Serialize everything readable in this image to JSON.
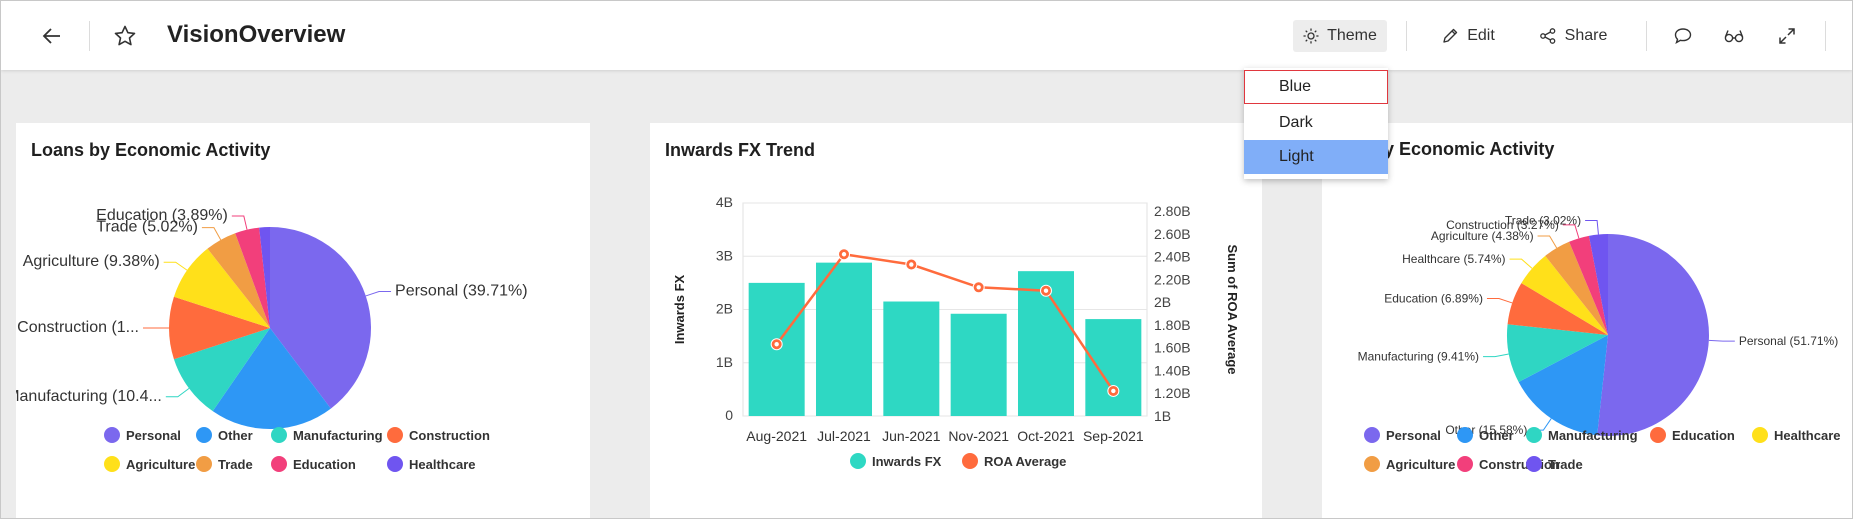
{
  "header": {
    "title": "VisionOverview",
    "theme_label": "Theme",
    "edit_label": "Edit",
    "share_label": "Share"
  },
  "theme_menu": {
    "options": [
      "Blue",
      "Dark",
      "Light"
    ],
    "hovered": "Blue",
    "selected": "Light"
  },
  "colors": {
    "personal": "#7b68ee",
    "other": "#2e97f5",
    "manufacturing": "#2fd6c3",
    "construction": "#ff6b3d",
    "agriculture": "#ffe01a",
    "trade": "#f19d44",
    "education": "#f23f7b",
    "healthcare": "#6f55f0",
    "bar": "#2ed8c3",
    "line": "#ff6b3d",
    "accent_selected": "#80aef8",
    "hover_border": "#e0373e"
  },
  "cards": {
    "loans": {
      "title": "Loans by Economic Activity"
    },
    "fx": {
      "title": "Inwards FX Trend"
    },
    "third": {
      "title": "t by Economic Activity"
    }
  },
  "chart_data": [
    {
      "type": "pie",
      "title": "Loans by Economic Activity",
      "slices": [
        {
          "name": "Personal",
          "value": 39.71,
          "label": "Personal (39.71%)",
          "color_key": "personal"
        },
        {
          "name": "Other",
          "value": 19.89,
          "label": "",
          "color_key": "other"
        },
        {
          "name": "Manufacturing",
          "value": 10.4,
          "label": "Manufacturing (10.4...",
          "color_key": "manufacturing"
        },
        {
          "name": "Construction",
          "value": 10.0,
          "label": "Construction (1...",
          "color_key": "construction"
        },
        {
          "name": "Agriculture",
          "value": 9.38,
          "label": "Agriculture (9.38%)",
          "color_key": "agriculture"
        },
        {
          "name": "Trade",
          "value": 5.02,
          "label": "Trade (5.02%)",
          "color_key": "trade"
        },
        {
          "name": "Education",
          "value": 3.89,
          "label": "Education (3.89%)",
          "color_key": "education"
        },
        {
          "name": "Healthcare",
          "value": 1.71,
          "label": "",
          "color_key": "healthcare"
        }
      ],
      "legend": [
        "Personal",
        "Other",
        "Manufacturing",
        "Construction",
        "Agriculture",
        "Trade",
        "Education",
        "Healthcare"
      ]
    },
    {
      "type": "bar",
      "title": "Inwards FX Trend",
      "categories": [
        "Aug-2021",
        "Jul-2021",
        "Jun-2021",
        "Nov-2021",
        "Oct-2021",
        "Sep-2021"
      ],
      "series": [
        {
          "name": "Inwards FX",
          "type": "bar",
          "axis": "left",
          "values": [
            2.5,
            2.88,
            2.15,
            1.92,
            2.72,
            1.82
          ]
        },
        {
          "name": "ROA Average",
          "type": "line",
          "axis": "right",
          "values": [
            1.63,
            2.42,
            2.33,
            2.13,
            2.1,
            1.22
          ]
        }
      ],
      "ylabel": "Inwards FX",
      "y2label": "Sum of ROA Average",
      "yticks": [
        "0",
        "1B",
        "2B",
        "3B",
        "4B"
      ],
      "ylim": [
        0,
        4
      ],
      "y2ticks": [
        "1B",
        "1.20B",
        "1.40B",
        "1.60B",
        "1.80B",
        "2B",
        "2.20B",
        "2.40B",
        "2.60B",
        "2.80B"
      ],
      "y2lim": [
        1.0,
        2.87
      ],
      "legend": [
        "Inwards FX",
        "ROA Average"
      ]
    },
    {
      "type": "pie",
      "title": "t by Economic Activity",
      "slices": [
        {
          "name": "Personal",
          "value": 51.71,
          "label": "Personal (51.71%)",
          "color_key": "personal"
        },
        {
          "name": "Other",
          "value": 15.58,
          "label": "Other (15.58%)",
          "color_key": "other"
        },
        {
          "name": "Manufacturing",
          "value": 9.41,
          "label": "Manufacturing (9.41%)",
          "color_key": "manufacturing"
        },
        {
          "name": "Education",
          "value": 6.89,
          "label": "Education (6.89%)",
          "color_key": "construction"
        },
        {
          "name": "Healthcare",
          "value": 5.74,
          "label": "Healthcare (5.74%)",
          "color_key": "agriculture"
        },
        {
          "name": "Agriculture",
          "value": 4.38,
          "label": "Agriculture (4.38%)",
          "color_key": "trade"
        },
        {
          "name": "Construction",
          "value": 3.27,
          "label": "Construction (3.27%)",
          "color_key": "education"
        },
        {
          "name": "Trade",
          "value": 3.02,
          "label": "Trade (3.02%)",
          "color_key": "healthcare"
        }
      ],
      "legend": [
        "Personal",
        "Other",
        "Manufacturing",
        "Education",
        "Healthcare",
        "Agriculture",
        "Construction",
        "Trade"
      ]
    }
  ]
}
